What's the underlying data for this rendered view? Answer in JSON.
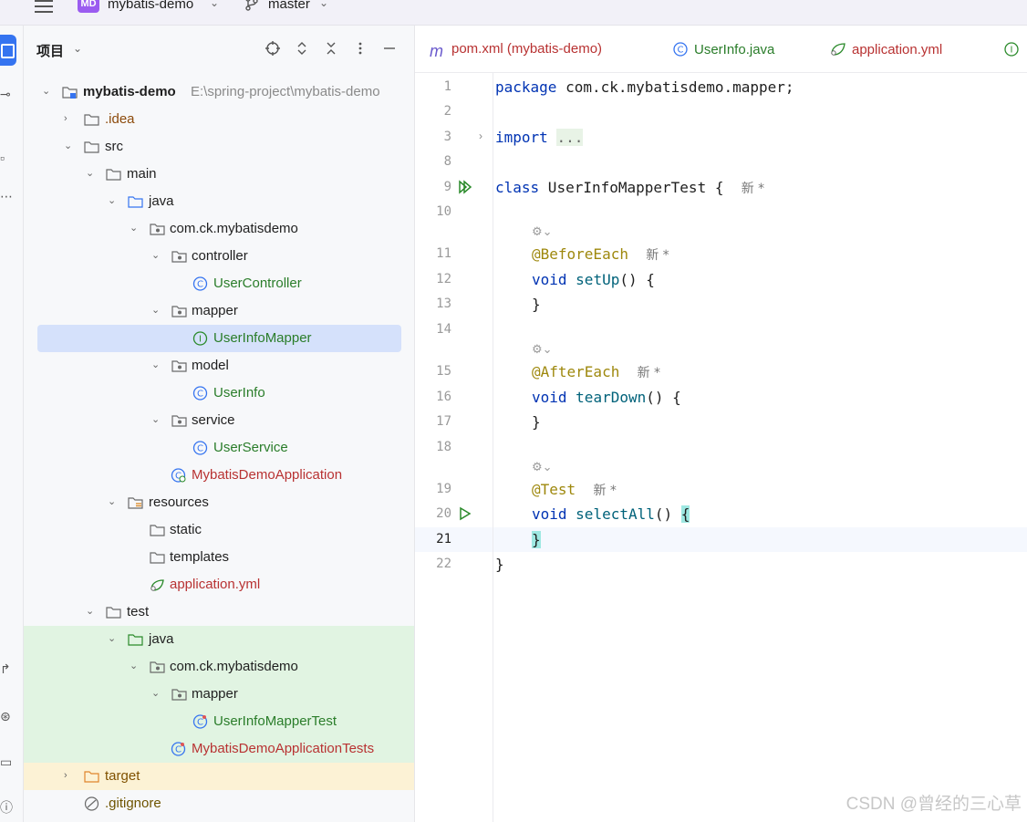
{
  "topbar": {
    "project_badge": "MD",
    "project_name": "mybatis-demo",
    "branch": "master"
  },
  "panel": {
    "title": "项目"
  },
  "tree": [
    {
      "label": "mybatis-demo",
      "path": "E:\\spring-project\\mybatis-demo",
      "icon": "module-folder-icon"
    },
    {
      "label": ".idea",
      "icon": "folder-icon"
    },
    {
      "label": "src",
      "icon": "folder-icon"
    },
    {
      "label": "main",
      "icon": "folder-icon"
    },
    {
      "label": "java",
      "icon": "source-folder-icon"
    },
    {
      "label": "com.ck.mybatisdemo",
      "icon": "package-icon"
    },
    {
      "label": "controller",
      "icon": "package-icon"
    },
    {
      "label": "UserController",
      "icon": "class-icon"
    },
    {
      "label": "mapper",
      "icon": "package-icon"
    },
    {
      "label": "UserInfoMapper",
      "icon": "interface-icon"
    },
    {
      "label": "model",
      "icon": "package-icon"
    },
    {
      "label": "UserInfo",
      "icon": "class-icon"
    },
    {
      "label": "service",
      "icon": "package-icon"
    },
    {
      "label": "UserService",
      "icon": "class-icon"
    },
    {
      "label": "MybatisDemoApplication",
      "icon": "spring-class-icon"
    },
    {
      "label": "resources",
      "icon": "resources-folder-icon"
    },
    {
      "label": "static",
      "icon": "folder-icon"
    },
    {
      "label": "templates",
      "icon": "folder-icon"
    },
    {
      "label": "application.yml",
      "icon": "spring-config-icon"
    },
    {
      "label": "test",
      "icon": "folder-icon"
    },
    {
      "label": "java",
      "icon": "test-source-folder-icon"
    },
    {
      "label": "com.ck.mybatisdemo",
      "icon": "package-icon"
    },
    {
      "label": "mapper",
      "icon": "package-icon"
    },
    {
      "label": "UserInfoMapperTest",
      "icon": "test-class-icon"
    },
    {
      "label": "MybatisDemoApplicationTests",
      "icon": "test-class-icon"
    },
    {
      "label": "target",
      "icon": "excluded-folder-icon"
    },
    {
      "label": ".gitignore",
      "icon": "ignored-file-icon"
    }
  ],
  "tabs": [
    {
      "label": "pom.xml (mybatis-demo)",
      "icon": "maven-icon"
    },
    {
      "label": "UserInfo.java",
      "icon": "class-icon"
    },
    {
      "label": "application.yml",
      "icon": "spring-config-icon"
    }
  ],
  "code": {
    "line_numbers": [
      "1",
      "2",
      "3",
      "8",
      "9",
      "10",
      "11",
      "12",
      "13",
      "14",
      "15",
      "16",
      "17",
      "18",
      "19",
      "20",
      "21",
      "22"
    ],
    "current_line": "21",
    "package_kw": "package",
    "package_name": " com.ck.mybatisdemo.mapper;",
    "import_kw": "import",
    "import_fold": "...",
    "class_kw": "class",
    "class_name": " UserInfoMapperTest {",
    "new_tag": "新 *",
    "ann_before": "@BeforeEach",
    "ann_after": "@AfterEach",
    "ann_test": "@Test",
    "void_kw": "void",
    "m_setup": "setUp",
    "m_teardown": "tearDown",
    "m_selectall": "selectAll",
    "parens": "()",
    "open_brace": "{",
    "close_brace": "}"
  },
  "watermark": "CSDN @曾经的三心草"
}
